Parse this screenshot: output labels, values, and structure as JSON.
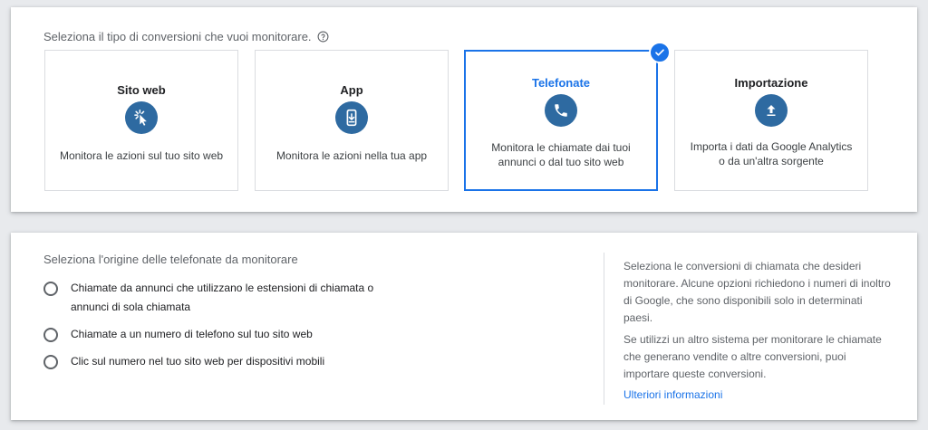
{
  "type_section": {
    "prompt": "Seleziona il tipo di conversioni che vuoi monitorare.",
    "help_icon": "help-circle-icon",
    "tiles": [
      {
        "title": "Sito web",
        "icon": "cursor-click-icon",
        "description": "Monitora le azioni sul tuo sito web",
        "selected": false
      },
      {
        "title": "App",
        "icon": "mobile-download-icon",
        "description": "Monitora le azioni nella tua app",
        "selected": false
      },
      {
        "title": "Telefonate",
        "icon": "phone-icon",
        "description": "Monitora le chiamate dai tuoi annunci o dal tuo sito web",
        "selected": true
      },
      {
        "title": "Importazione",
        "icon": "upload-icon",
        "description": "Importa i dati da Google Analytics o da un'altra sorgente",
        "selected": false
      }
    ],
    "selected_badge_icon": "checkmark-icon"
  },
  "source_section": {
    "title": "Seleziona l'origine delle telefonate da monitorare",
    "options": [
      {
        "label": "Chiamate da annunci che utilizzano le estensioni di chiamata o annunci di sola chiamata",
        "checked": false
      },
      {
        "label": "Chiamate a un numero di telefono sul tuo sito web",
        "checked": false
      },
      {
        "label": "Clic sul numero nel tuo sito web per dispositivi mobili",
        "checked": false
      }
    ],
    "info_paragraphs": [
      "Seleziona le conversioni di chiamata che desideri monitorare. Alcune opzioni richiedono i numeri di inoltro di Google, che sono disponibili solo in determinati paesi.",
      "Se utilizzi un altro sistema per monitorare le chiamate che generano vendite o altre conversioni, puoi importare queste conversioni."
    ],
    "learn_more": "Ulteriori informazioni"
  },
  "colors": {
    "accent": "#1a73e8",
    "icon_bg": "#2e6aa1",
    "page_bg": "#e8eaed"
  }
}
